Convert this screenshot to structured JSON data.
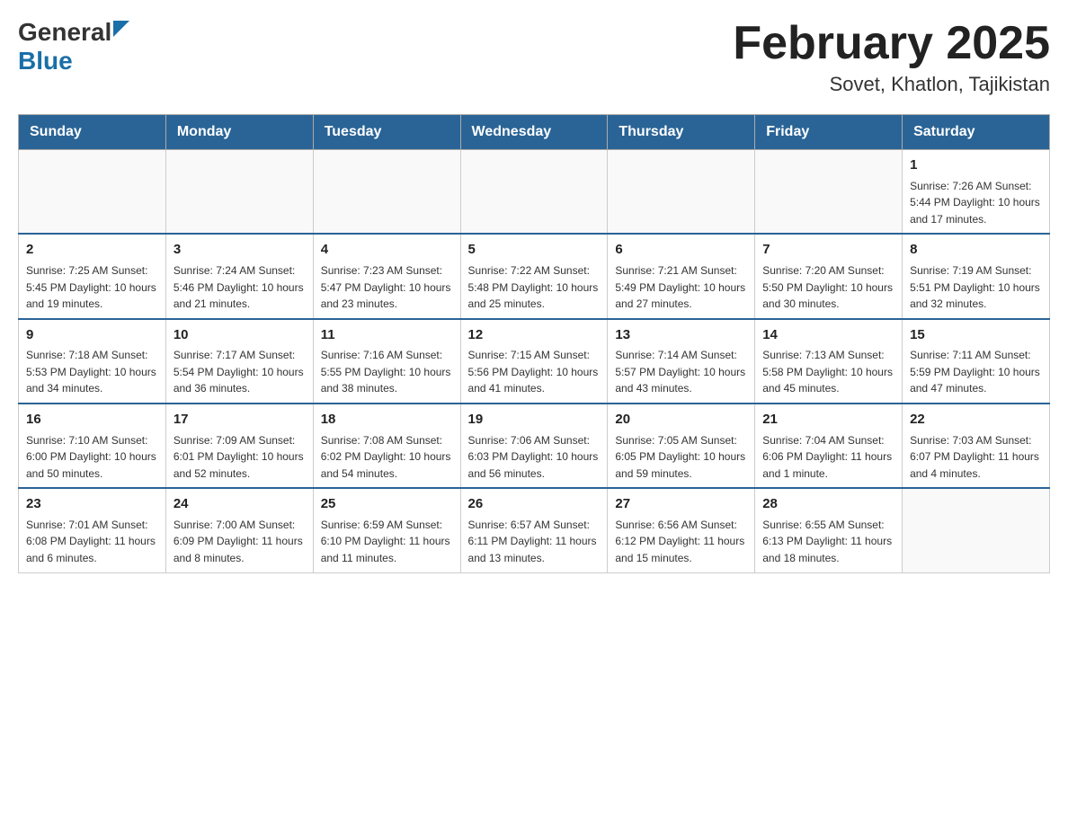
{
  "header": {
    "logo_general": "General",
    "logo_blue": "Blue",
    "month_title": "February 2025",
    "location": "Sovet, Khatlon, Tajikistan"
  },
  "weekdays": [
    "Sunday",
    "Monday",
    "Tuesday",
    "Wednesday",
    "Thursday",
    "Friday",
    "Saturday"
  ],
  "weeks": [
    [
      {
        "day": "",
        "info": ""
      },
      {
        "day": "",
        "info": ""
      },
      {
        "day": "",
        "info": ""
      },
      {
        "day": "",
        "info": ""
      },
      {
        "day": "",
        "info": ""
      },
      {
        "day": "",
        "info": ""
      },
      {
        "day": "1",
        "info": "Sunrise: 7:26 AM\nSunset: 5:44 PM\nDaylight: 10 hours and 17 minutes."
      }
    ],
    [
      {
        "day": "2",
        "info": "Sunrise: 7:25 AM\nSunset: 5:45 PM\nDaylight: 10 hours and 19 minutes."
      },
      {
        "day": "3",
        "info": "Sunrise: 7:24 AM\nSunset: 5:46 PM\nDaylight: 10 hours and 21 minutes."
      },
      {
        "day": "4",
        "info": "Sunrise: 7:23 AM\nSunset: 5:47 PM\nDaylight: 10 hours and 23 minutes."
      },
      {
        "day": "5",
        "info": "Sunrise: 7:22 AM\nSunset: 5:48 PM\nDaylight: 10 hours and 25 minutes."
      },
      {
        "day": "6",
        "info": "Sunrise: 7:21 AM\nSunset: 5:49 PM\nDaylight: 10 hours and 27 minutes."
      },
      {
        "day": "7",
        "info": "Sunrise: 7:20 AM\nSunset: 5:50 PM\nDaylight: 10 hours and 30 minutes."
      },
      {
        "day": "8",
        "info": "Sunrise: 7:19 AM\nSunset: 5:51 PM\nDaylight: 10 hours and 32 minutes."
      }
    ],
    [
      {
        "day": "9",
        "info": "Sunrise: 7:18 AM\nSunset: 5:53 PM\nDaylight: 10 hours and 34 minutes."
      },
      {
        "day": "10",
        "info": "Sunrise: 7:17 AM\nSunset: 5:54 PM\nDaylight: 10 hours and 36 minutes."
      },
      {
        "day": "11",
        "info": "Sunrise: 7:16 AM\nSunset: 5:55 PM\nDaylight: 10 hours and 38 minutes."
      },
      {
        "day": "12",
        "info": "Sunrise: 7:15 AM\nSunset: 5:56 PM\nDaylight: 10 hours and 41 minutes."
      },
      {
        "day": "13",
        "info": "Sunrise: 7:14 AM\nSunset: 5:57 PM\nDaylight: 10 hours and 43 minutes."
      },
      {
        "day": "14",
        "info": "Sunrise: 7:13 AM\nSunset: 5:58 PM\nDaylight: 10 hours and 45 minutes."
      },
      {
        "day": "15",
        "info": "Sunrise: 7:11 AM\nSunset: 5:59 PM\nDaylight: 10 hours and 47 minutes."
      }
    ],
    [
      {
        "day": "16",
        "info": "Sunrise: 7:10 AM\nSunset: 6:00 PM\nDaylight: 10 hours and 50 minutes."
      },
      {
        "day": "17",
        "info": "Sunrise: 7:09 AM\nSunset: 6:01 PM\nDaylight: 10 hours and 52 minutes."
      },
      {
        "day": "18",
        "info": "Sunrise: 7:08 AM\nSunset: 6:02 PM\nDaylight: 10 hours and 54 minutes."
      },
      {
        "day": "19",
        "info": "Sunrise: 7:06 AM\nSunset: 6:03 PM\nDaylight: 10 hours and 56 minutes."
      },
      {
        "day": "20",
        "info": "Sunrise: 7:05 AM\nSunset: 6:05 PM\nDaylight: 10 hours and 59 minutes."
      },
      {
        "day": "21",
        "info": "Sunrise: 7:04 AM\nSunset: 6:06 PM\nDaylight: 11 hours and 1 minute."
      },
      {
        "day": "22",
        "info": "Sunrise: 7:03 AM\nSunset: 6:07 PM\nDaylight: 11 hours and 4 minutes."
      }
    ],
    [
      {
        "day": "23",
        "info": "Sunrise: 7:01 AM\nSunset: 6:08 PM\nDaylight: 11 hours and 6 minutes."
      },
      {
        "day": "24",
        "info": "Sunrise: 7:00 AM\nSunset: 6:09 PM\nDaylight: 11 hours and 8 minutes."
      },
      {
        "day": "25",
        "info": "Sunrise: 6:59 AM\nSunset: 6:10 PM\nDaylight: 11 hours and 11 minutes."
      },
      {
        "day": "26",
        "info": "Sunrise: 6:57 AM\nSunset: 6:11 PM\nDaylight: 11 hours and 13 minutes."
      },
      {
        "day": "27",
        "info": "Sunrise: 6:56 AM\nSunset: 6:12 PM\nDaylight: 11 hours and 15 minutes."
      },
      {
        "day": "28",
        "info": "Sunrise: 6:55 AM\nSunset: 6:13 PM\nDaylight: 11 hours and 18 minutes."
      },
      {
        "day": "",
        "info": ""
      }
    ]
  ]
}
